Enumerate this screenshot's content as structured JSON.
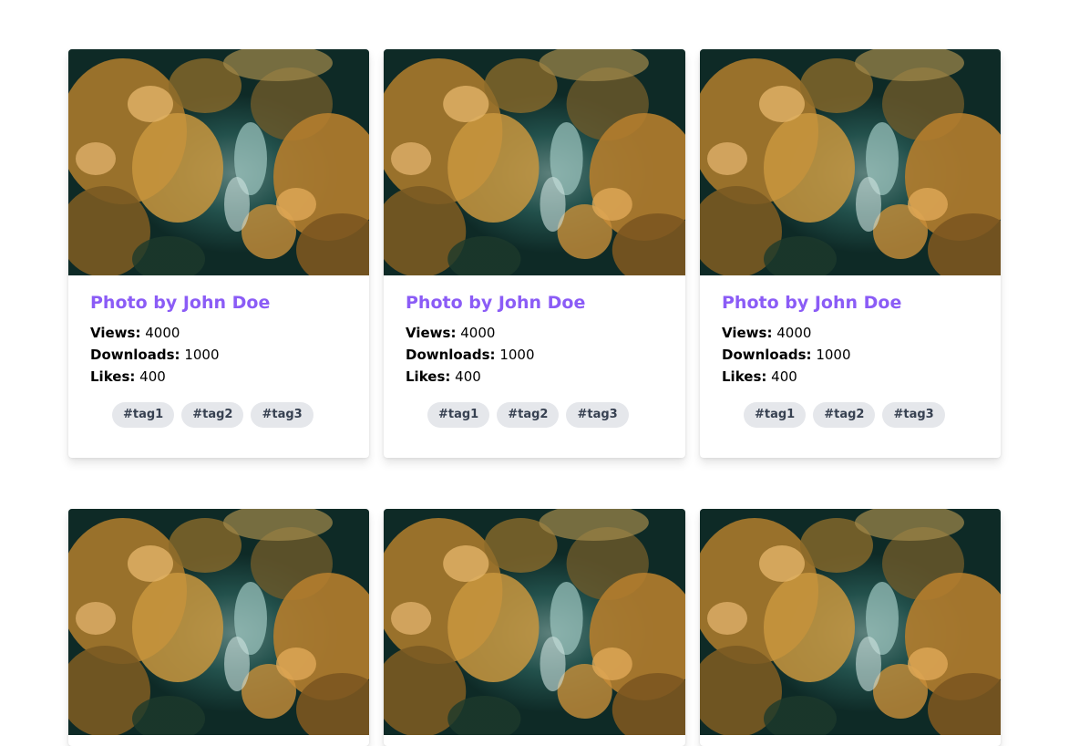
{
  "theme": {
    "accent": "#8b5cf6",
    "tag_bg": "#e5e7eb",
    "tag_text": "#374151"
  },
  "stat_labels": {
    "views": "Views:",
    "downloads": "Downloads:",
    "likes": "Likes:"
  },
  "cards": [
    {
      "title": "Photo by John Doe",
      "views": "4000",
      "downloads": "1000",
      "likes": "400",
      "tags": [
        "#tag1",
        "#tag2",
        "#tag3"
      ],
      "image": "aerial-forest-photo"
    },
    {
      "title": "Photo by John Doe",
      "views": "4000",
      "downloads": "1000",
      "likes": "400",
      "tags": [
        "#tag1",
        "#tag2",
        "#tag3"
      ],
      "image": "aerial-forest-photo"
    },
    {
      "title": "Photo by John Doe",
      "views": "4000",
      "downloads": "1000",
      "likes": "400",
      "tags": [
        "#tag1",
        "#tag2",
        "#tag3"
      ],
      "image": "aerial-forest-photo"
    },
    {
      "image": "aerial-forest-photo"
    },
    {
      "image": "aerial-forest-photo"
    },
    {
      "image": "aerial-forest-photo"
    }
  ]
}
